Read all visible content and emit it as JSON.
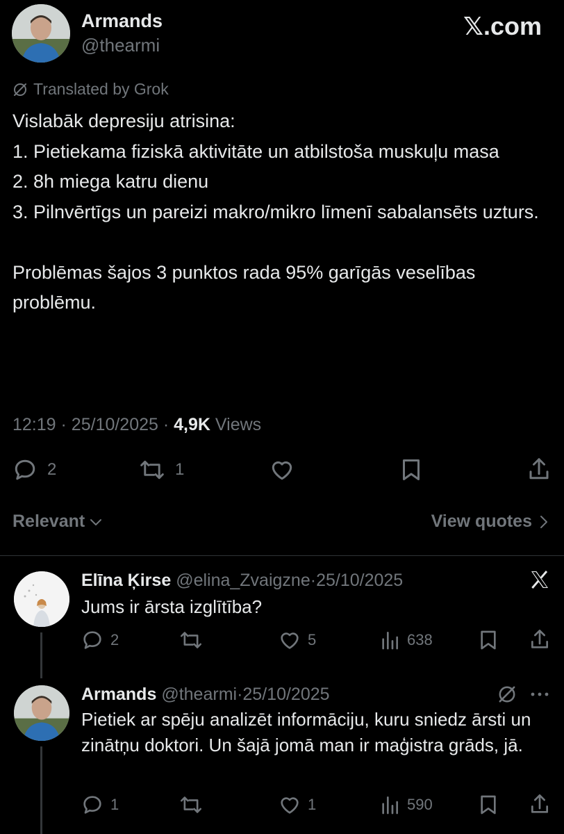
{
  "watermark": "𝕏.com",
  "main_post": {
    "author_name": "Armands",
    "author_handle": "@thearmi",
    "translated_label": "Translated by Grok",
    "text": "Vislabāk depresiju atrisina:\n1. Pietiekama fiziskā aktivitāte un atbilstoša muskuļu masa\n2. 8h miega katru dienu\n3. Pilnvērtīgs un pareizi makro/mikro līmenī sabalansēts uzturs.\n\nProblēmas šajos 3 punktos rada 95% garīgās veselības problēmu.",
    "time": "12:19",
    "date": "25/10/2025",
    "views_count": "4,9K",
    "views_label": "Views",
    "reply_count": "2",
    "repost_count": "1"
  },
  "sort": {
    "label": "Relevant",
    "view_quotes_label": "View quotes"
  },
  "replies": [
    {
      "author_name": "Elīna Ķirse",
      "author_handle": "@elina_Zvaigzne",
      "date": "25/10/2025",
      "text": "Jums ir ārsta izglītība?",
      "reply_count": "2",
      "repost_count": "",
      "like_count": "5",
      "views_count": "638"
    },
    {
      "author_name": "Armands",
      "author_handle": "@thearmi",
      "date": "25/10/2025",
      "text": "Pietiek ar spēju analizēt informāciju, kuru sniedz ārsti un zinātņu doktori. Un šajā jomā man ir maģistra grāds, jā.",
      "reply_count": "1",
      "repost_count": "",
      "like_count": "1",
      "views_count": "590"
    }
  ],
  "icons": [
    "reply-icon",
    "repost-icon",
    "like-icon",
    "bookmark-icon",
    "share-icon",
    "views-icon",
    "grok-translate-icon",
    "x-logo-icon",
    "more-icon",
    "chevron-down-icon",
    "chevron-right-icon"
  ]
}
